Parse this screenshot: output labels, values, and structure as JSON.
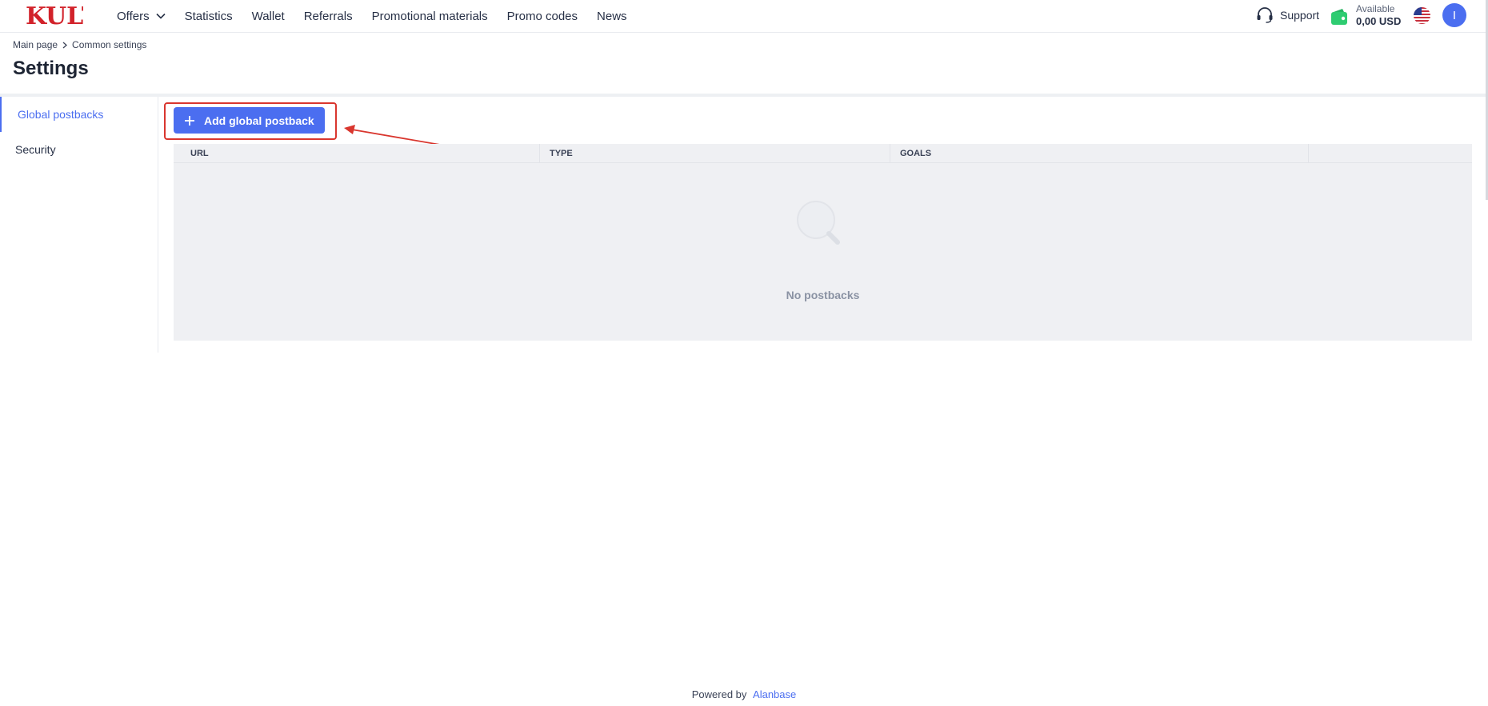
{
  "header": {
    "logo_text": "KULT",
    "nav": [
      {
        "label": "Offers",
        "has_dropdown": true
      },
      {
        "label": "Statistics"
      },
      {
        "label": "Wallet"
      },
      {
        "label": "Referrals"
      },
      {
        "label": "Promotional materials"
      },
      {
        "label": "Promo codes"
      },
      {
        "label": "News"
      }
    ],
    "support_label": "Support",
    "balance_label": "Available",
    "balance_value": "0,00 USD",
    "language": "us-flag-icon",
    "avatar_initial": "I"
  },
  "breadcrumb": {
    "items": [
      "Main page",
      "Common settings"
    ]
  },
  "page_title": "Settings",
  "sidebar": {
    "items": [
      {
        "label": "Global postbacks",
        "active": true
      },
      {
        "label": "Security",
        "active": false
      }
    ]
  },
  "main": {
    "add_button_label": "Add global postback",
    "table": {
      "columns": [
        "URL",
        "TYPE",
        "GOALS",
        ""
      ],
      "empty_text": "No postbacks"
    }
  },
  "footer": {
    "powered_by": "Powered by",
    "brand": "Alanbase"
  },
  "colors": {
    "accent": "#4b6ef0",
    "annotation": "#d9362e",
    "wallet": "#2ecc71",
    "logo": "#d2222a"
  }
}
